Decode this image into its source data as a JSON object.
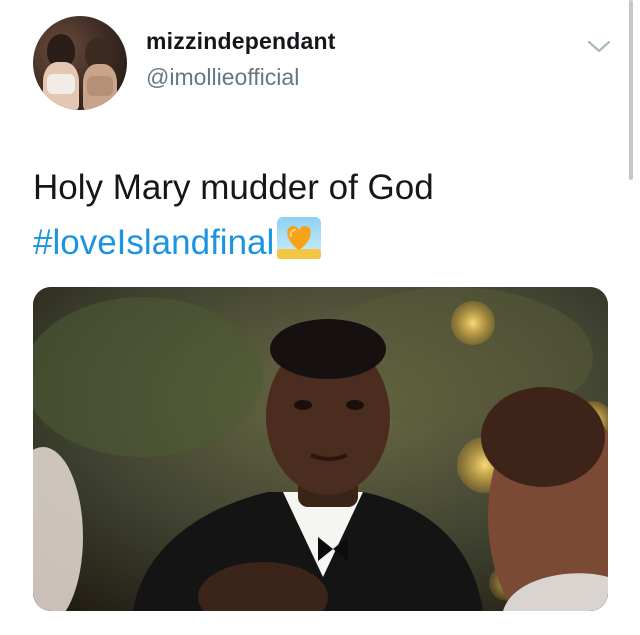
{
  "tweet": {
    "display_name": "mizzindependant",
    "handle": "@imollieofficial",
    "text": "Holy Mary mudder of God",
    "hashtag": "#loveIslandfinal",
    "hashtag_emoji": "sunset-heart-emoji",
    "menu_icon": "chevron-down-icon",
    "media_description": "photo"
  },
  "colors": {
    "text": "#14171a",
    "secondary": "#657786",
    "link": "#1b95e0"
  }
}
